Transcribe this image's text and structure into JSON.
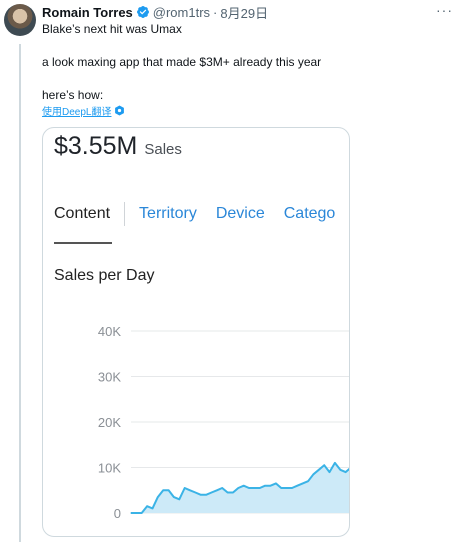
{
  "post": {
    "author": "Romain Torres",
    "handle": "@rom1trs",
    "separator": "·",
    "date": "8月29日",
    "more_label": "···",
    "line1": "Blake’s next hit was Umax",
    "line2": "a look maxing app that made $3M+ already this year",
    "line3": "here’s how:",
    "translate_label": "使用DeepL翻译"
  },
  "media": {
    "sales_value": "$3.55M",
    "sales_label": "Sales",
    "tab_active": "Content",
    "tabs": [
      "Territory",
      "Device",
      "Catego"
    ],
    "chart_title": "Sales per Day"
  },
  "colors": {
    "accent": "#1d9bf0",
    "tab_link": "#2b87d8",
    "area_fill": "#cdeaf8",
    "area_line": "#3bb3e6"
  },
  "chart_data": {
    "type": "area",
    "title": "Sales per Day",
    "yticks": [
      "0",
      "10K",
      "20K",
      "30K",
      "40K"
    ],
    "ylim": [
      0,
      40000
    ],
    "grid": true,
    "values": [
      0,
      0,
      0,
      1500,
      1000,
      3500,
      5000,
      5000,
      3500,
      3000,
      5500,
      5000,
      4500,
      4000,
      4000,
      4500,
      5000,
      5500,
      4500,
      4500,
      5500,
      6000,
      5500,
      5500,
      5500,
      6000,
      6000,
      6500,
      5500,
      5500,
      5500,
      6000,
      6500,
      7000,
      8500,
      9500,
      10500,
      9000,
      11000,
      9500,
      9000,
      10000
    ]
  }
}
